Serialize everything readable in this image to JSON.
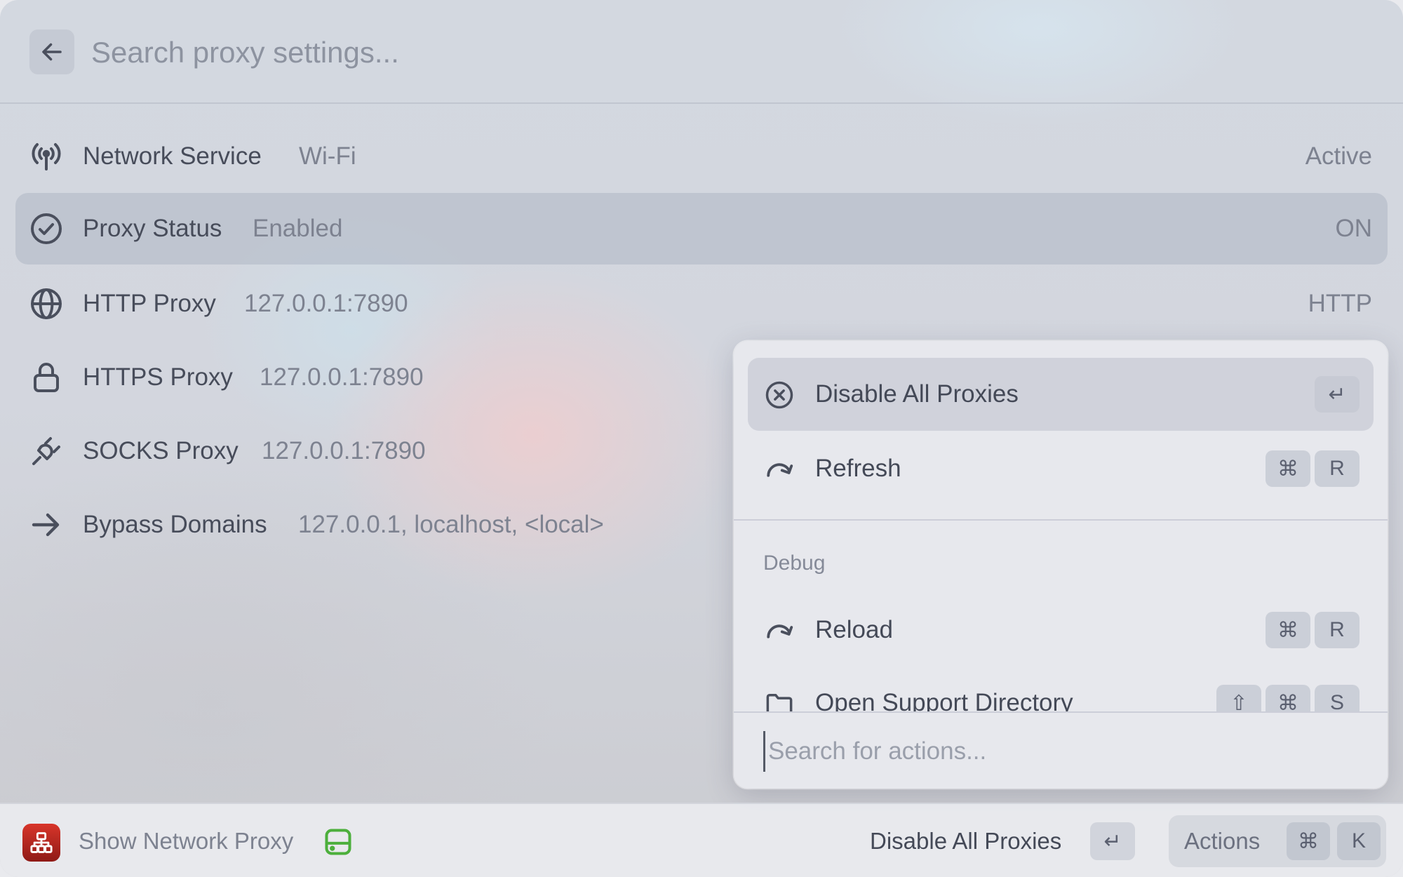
{
  "search": {
    "placeholder": "Search proxy settings..."
  },
  "list": [
    {
      "title": "Network Service",
      "subtitle": "Wi-Fi",
      "accessory": "Active",
      "icon": "antenna-icon"
    },
    {
      "title": "Proxy Status",
      "subtitle": "Enabled",
      "accessory": "ON",
      "icon": "checkmark-circle-icon"
    },
    {
      "title": "HTTP Proxy",
      "subtitle": "127.0.0.1:7890",
      "accessory": "HTTP",
      "icon": "globe-icon"
    },
    {
      "title": "HTTPS Proxy",
      "subtitle": "127.0.0.1:7890",
      "accessory": "",
      "icon": "lock-icon"
    },
    {
      "title": "SOCKS Proxy",
      "subtitle": "127.0.0.1:7890",
      "accessory": "",
      "icon": "plug-icon"
    },
    {
      "title": "Bypass Domains",
      "subtitle": "127.0.0.1, localhost, <local>",
      "accessory": "",
      "icon": "arrow-right-icon"
    }
  ],
  "action_panel": {
    "actions": [
      {
        "label": "Disable All Proxies",
        "keys": [
          "↵"
        ],
        "icon": "x-circle-icon"
      },
      {
        "label": "Refresh",
        "keys": [
          "⌘",
          "R"
        ],
        "icon": "redo-arrow-icon"
      }
    ],
    "section_title": "Debug",
    "debug_actions": [
      {
        "label": "Reload",
        "keys": [
          "⌘",
          "R"
        ],
        "icon": "redo-arrow-icon"
      },
      {
        "label": "Open Support Directory",
        "keys": [
          "⇧",
          "⌘",
          "S"
        ],
        "icon": "folder-icon"
      }
    ],
    "search_placeholder": "Search for actions..."
  },
  "footer": {
    "command_title": "Show Network Proxy",
    "primary_action": "Disable All Proxies",
    "primary_key": "↵",
    "actions_label": "Actions",
    "actions_keys": [
      "⌘",
      "K"
    ]
  },
  "colors": {
    "icon": "#4a4f5d",
    "app_icon": "#c3271f",
    "disk_icon": "#4caf3c"
  }
}
